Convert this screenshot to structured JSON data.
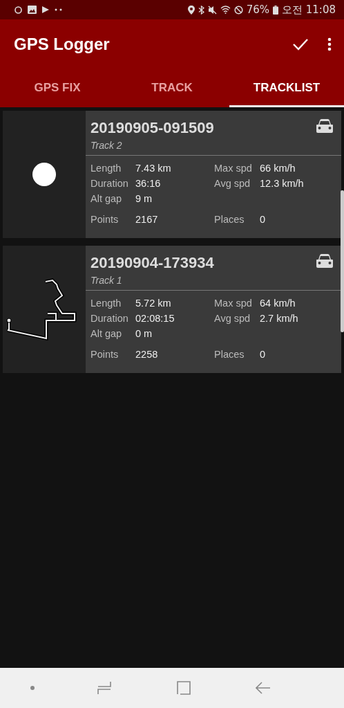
{
  "status_bar": {
    "battery": "76%",
    "time": "오전 11:08"
  },
  "app_bar": {
    "title": "GPS Logger"
  },
  "tabs": [
    {
      "label": "GPS FIX",
      "selected": false
    },
    {
      "label": "TRACK",
      "selected": false
    },
    {
      "label": "TRACKLIST",
      "selected": true
    }
  ],
  "tracks": [
    {
      "name": "20190905-091509",
      "description": "Track 2",
      "kind": "dot",
      "stats": [
        {
          "label": "Length",
          "value": "7.43 km"
        },
        {
          "label": "Max spd",
          "value": "66 km/h"
        },
        {
          "label": "Duration",
          "value": "36:16"
        },
        {
          "label": "Avg spd",
          "value": "12.3 km/h"
        },
        {
          "label": "Alt gap",
          "value": "9 m"
        }
      ],
      "points": {
        "label": "Points",
        "value": "2167"
      },
      "places": {
        "label": "Places",
        "value": "0"
      }
    },
    {
      "name": "20190904-173934",
      "description": "Track 1",
      "kind": "route",
      "stats": [
        {
          "label": "Length",
          "value": "5.72 km"
        },
        {
          "label": "Max spd",
          "value": "64 km/h"
        },
        {
          "label": "Duration",
          "value": "02:08:15"
        },
        {
          "label": "Avg spd",
          "value": "2.7 km/h"
        },
        {
          "label": "Alt gap",
          "value": "0 m"
        }
      ],
      "points": {
        "label": "Points",
        "value": "2258"
      },
      "places": {
        "label": "Places",
        "value": "0"
      }
    }
  ]
}
